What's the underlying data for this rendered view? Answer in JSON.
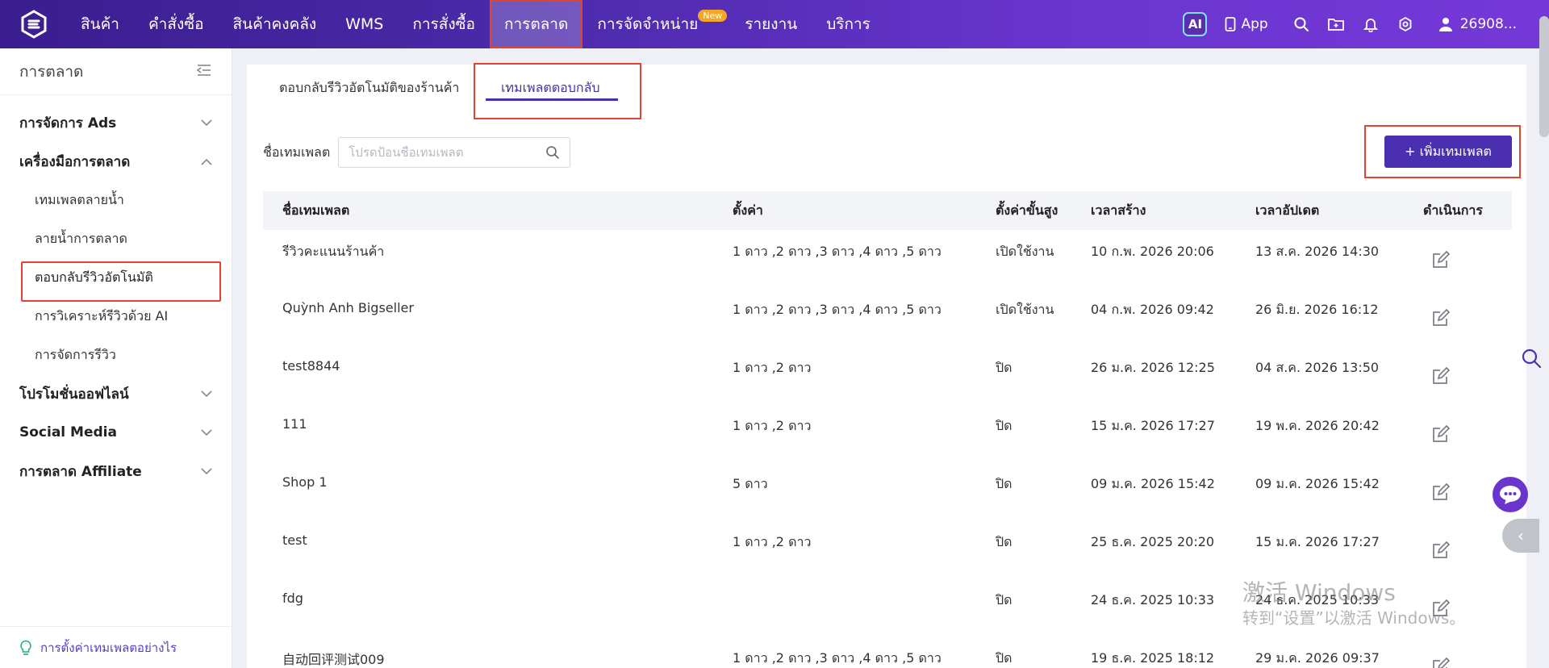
{
  "nav": {
    "items": [
      {
        "label": "สินค้า"
      },
      {
        "label": "คำสั่งซื้อ"
      },
      {
        "label": "สินค้าคงคลัง"
      },
      {
        "label": "WMS"
      },
      {
        "label": "การสั่งซื้อ"
      },
      {
        "label": "การตลาด",
        "active": true
      },
      {
        "label": "การจัดจำหน่าย",
        "badge": "New"
      },
      {
        "label": "รายงาน"
      },
      {
        "label": "บริการ"
      }
    ],
    "ai_label": "AI",
    "app_label": "App",
    "user_label": "26908..."
  },
  "sidebar": {
    "title": "การตลาด",
    "groups": [
      {
        "label": "การจัดการ Ads",
        "expanded": false
      },
      {
        "label": "เครื่องมือการตลาด",
        "expanded": true,
        "children": [
          "เทมเพลตลายน้ำ",
          "ลายน้ำการตลาด",
          "ตอบกลับรีวิวอัตโนมัติ",
          "การวิเคราะห์รีวิวด้วย AI",
          "การจัดการรีวิว"
        ]
      },
      {
        "label": "โปรโมชั่นออฟไลน์",
        "expanded": false
      },
      {
        "label": "Social Media",
        "expanded": false
      },
      {
        "label": "การตลาด Affiliate",
        "expanded": false
      }
    ],
    "footer_link": "การตั้งค่าเทมเพลตอย่างไร"
  },
  "tabs": {
    "tab1": "ตอบกลับรีวิวอัตโนมัติของร้านค้า",
    "tab2": "เทมเพลตตอบกลับ"
  },
  "filter": {
    "label": "ชื่อเทมเพลต",
    "placeholder": "โปรดป้อนชื่อเทมเพลต"
  },
  "add_button": "+ เพิ่มเทมเพลต",
  "table": {
    "headers": [
      "ชื่อเทมเพลต",
      "ตั้งค่า",
      "ตั้งค่าขั้นสูง",
      "เวลาสร้าง",
      "เวลาอัปเดต",
      "ดำเนินการ"
    ],
    "rows": [
      [
        "รีวิวคะแนนร้านค้า",
        "1 ดาว ,2 ดาว ,3 ดาว ,4 ดาว ,5 ดาว",
        "เปิดใช้งาน",
        "10 ก.พ. 2026 20:06",
        "13 ส.ค. 2026 14:30"
      ],
      [
        "Quỳnh Anh Bigseller",
        "1 ดาว ,2 ดาว ,3 ดาว ,4 ดาว ,5 ดาว",
        "เปิดใช้งาน",
        "04 ก.พ. 2026 09:42",
        "26 มิ.ย. 2026 16:12"
      ],
      [
        "test8844",
        "1 ดาว ,2 ดาว",
        "ปิด",
        "26 ม.ค. 2026 12:25",
        "04 ส.ค. 2026 13:50"
      ],
      [
        "111",
        "1 ดาว ,2 ดาว",
        "ปิด",
        "15 ม.ค. 2026 17:27",
        "19 พ.ค. 2026 20:42"
      ],
      [
        "Shop 1",
        "5 ดาว",
        "ปิด",
        "09 ม.ค. 2026 15:42",
        "09 ม.ค. 2026 15:42"
      ],
      [
        "test",
        "1 ดาว ,2 ดาว",
        "ปิด",
        "25 ธ.ค. 2025 20:20",
        "15 ม.ค. 2026 17:27"
      ],
      [
        "fdg",
        "",
        "ปิด",
        "24 ธ.ค. 2025 10:33",
        "24 ธ.ค. 2025 10:33"
      ],
      [
        "自动回评测试009",
        "1 ดาว ,2 ดาว ,3 ดาว ,4 ดาว ,5 ดาว",
        "ปิด",
        "19 ธ.ค. 2025 18:12",
        "29 ม.ค. 2026 09:37"
      ]
    ]
  },
  "watermark": {
    "line1": "激活 Windows",
    "line2": "转到“设置”以激活 Windows。"
  },
  "colors": {
    "accent": "#4a2fb0",
    "highlight_border": "#e0432f",
    "badge": "#f5a623"
  }
}
